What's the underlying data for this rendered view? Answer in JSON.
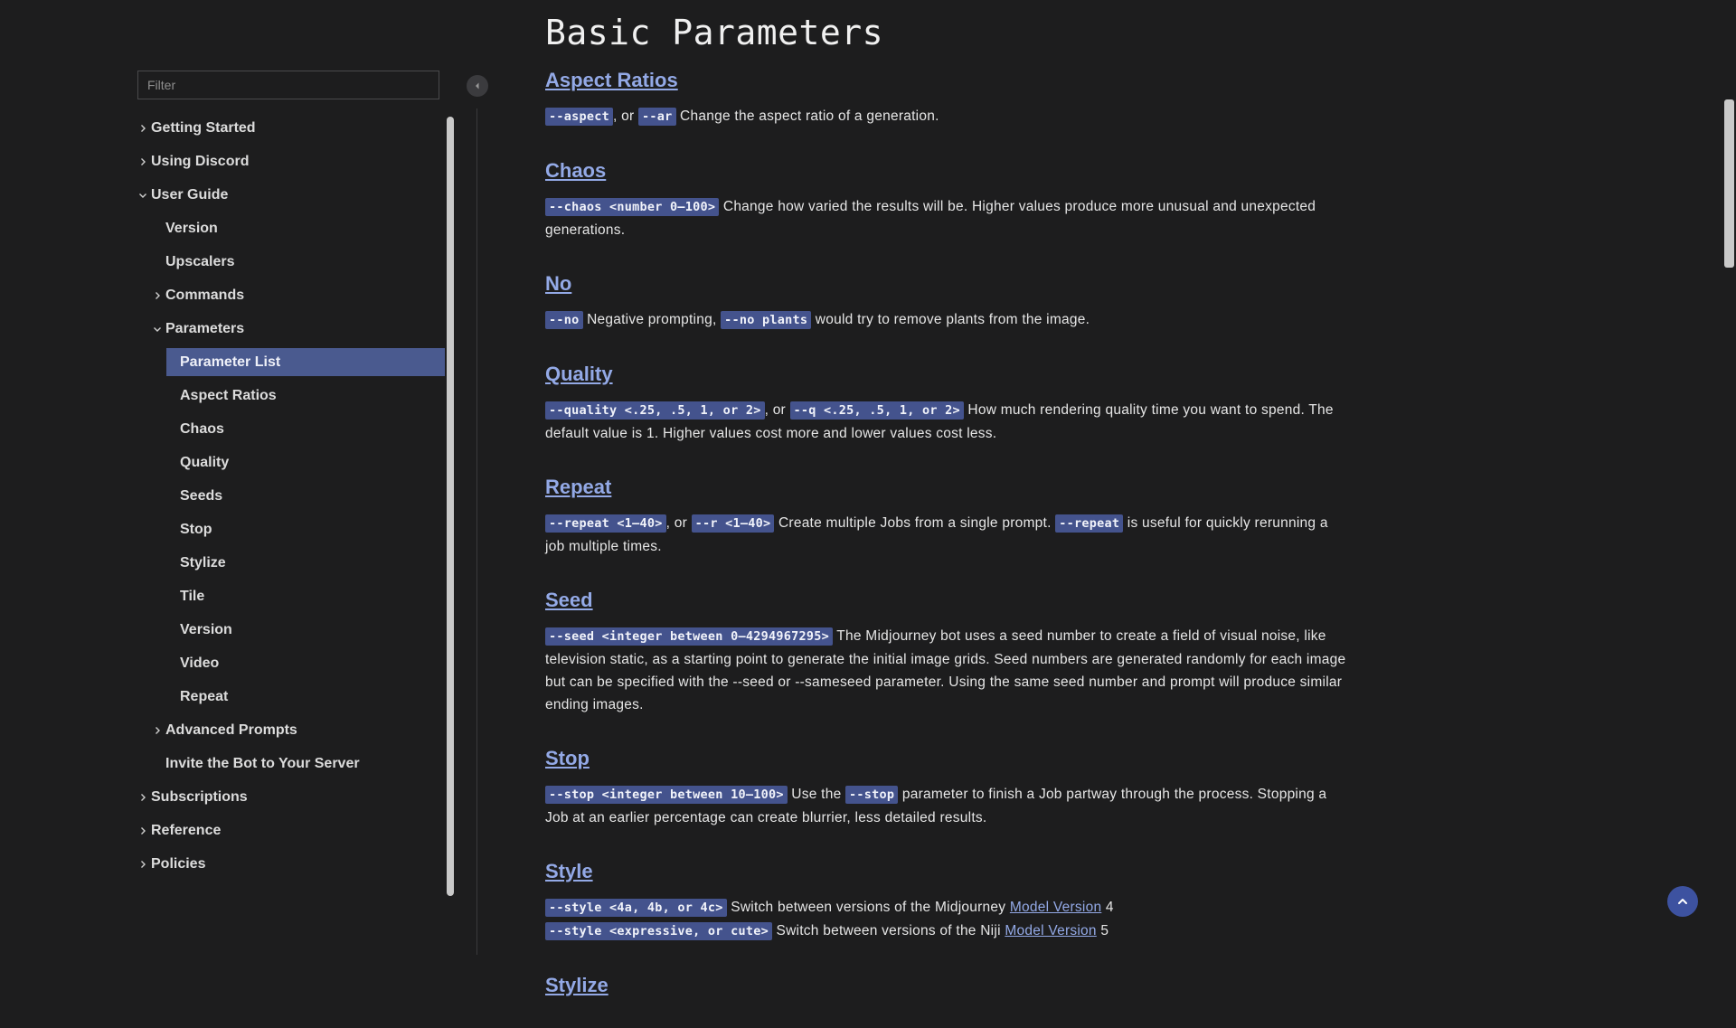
{
  "sidebar": {
    "filter_placeholder": "Filter",
    "items": [
      {
        "label": "Getting Started",
        "level": 0,
        "chevron": "right"
      },
      {
        "label": "Using Discord",
        "level": 0,
        "chevron": "right"
      },
      {
        "label": "User Guide",
        "level": 0,
        "chevron": "down"
      },
      {
        "label": "Version",
        "level": 1,
        "chevron": ""
      },
      {
        "label": "Upscalers",
        "level": 1,
        "chevron": ""
      },
      {
        "label": "Commands",
        "level": 1,
        "chevron": "right"
      },
      {
        "label": "Parameters",
        "level": 1,
        "chevron": "down"
      },
      {
        "label": "Parameter List",
        "level": 2,
        "chevron": "",
        "active": true
      },
      {
        "label": "Aspect Ratios",
        "level": 2,
        "chevron": ""
      },
      {
        "label": "Chaos",
        "level": 2,
        "chevron": ""
      },
      {
        "label": "Quality",
        "level": 2,
        "chevron": ""
      },
      {
        "label": "Seeds",
        "level": 2,
        "chevron": ""
      },
      {
        "label": "Stop",
        "level": 2,
        "chevron": ""
      },
      {
        "label": "Stylize",
        "level": 2,
        "chevron": ""
      },
      {
        "label": "Tile",
        "level": 2,
        "chevron": ""
      },
      {
        "label": "Version",
        "level": 2,
        "chevron": ""
      },
      {
        "label": "Video",
        "level": 2,
        "chevron": ""
      },
      {
        "label": "Repeat",
        "level": 2,
        "chevron": ""
      },
      {
        "label": "Advanced Prompts",
        "level": 1,
        "chevron": "right"
      },
      {
        "label": "Invite the Bot to Your Server",
        "level": 1,
        "chevron": ""
      },
      {
        "label": "Subscriptions",
        "level": 0,
        "chevron": "right"
      },
      {
        "label": "Reference",
        "level": 0,
        "chevron": "right"
      },
      {
        "label": "Policies",
        "level": 0,
        "chevron": "right"
      }
    ]
  },
  "page": {
    "title": "Basic Parameters"
  },
  "sections": {
    "aspect": {
      "title": "Aspect Ratios",
      "code1": "--aspect",
      "sep1": ", or ",
      "code2": "--ar",
      "text": " Change the aspect ratio of a generation."
    },
    "chaos": {
      "title": "Chaos",
      "code1": "--chaos <number 0–100>",
      "text": " Change how varied the results will be. Higher values produce more unusual and unexpected generations."
    },
    "no": {
      "title": "No",
      "code1": "--no",
      "text1": " Negative prompting, ",
      "code2": "--no plants",
      "text2": " would try to remove plants from the image."
    },
    "quality": {
      "title": "Quality",
      "code1": "--quality <.25, .5, 1, or 2>",
      "sep1": ", or ",
      "code2": "--q <.25, .5, 1, or 2>",
      "text": " How much rendering quality time you want to spend. The default value is 1. Higher values cost more and lower values cost less."
    },
    "repeat": {
      "title": "Repeat",
      "code1": "--repeat <1–40>",
      "sep1": ", or ",
      "code2": "--r <1–40>",
      "text1": " Create multiple Jobs from a single prompt. ",
      "code3": "--repeat",
      "text2": " is useful for quickly rerunning a job multiple times."
    },
    "seed": {
      "title": "Seed",
      "code1": "--seed <integer between 0–4294967295>",
      "text": " The Midjourney bot uses a seed number to create a field of visual noise, like television static, as a starting point to generate the initial image grids. Seed numbers are generated randomly for each image but can be specified with the --seed or --sameseed parameter. Using the same seed number and prompt will produce similar ending images."
    },
    "stop": {
      "title": "Stop",
      "code1": "--stop <integer between 10–100>",
      "text1": " Use the ",
      "code2": "--stop",
      "text2": " parameter to finish a Job partway through the process. Stopping a Job at an earlier percentage can create blurrier, less detailed results."
    },
    "style": {
      "title": "Style",
      "code1": "--style <4a, 4b, or 4c>",
      "text1": " Switch between versions of the Midjourney ",
      "link1": "Model Version",
      "text2": " 4",
      "code2": "--style <expressive, or cute>",
      "text3": " Switch between versions of the Niji ",
      "link2": "Model Version",
      "text4": " 5"
    },
    "stylize": {
      "title": "Stylize"
    }
  },
  "icons": {
    "collapse": "chevron-left-icon",
    "back_to_top": "chevron-up-icon"
  },
  "colors": {
    "background": "#1d1d1e",
    "accent_active": "#4a5a8f",
    "code_bg": "#44538d",
    "link": "#93a9e6",
    "back_to_top": "#3d52a0"
  }
}
